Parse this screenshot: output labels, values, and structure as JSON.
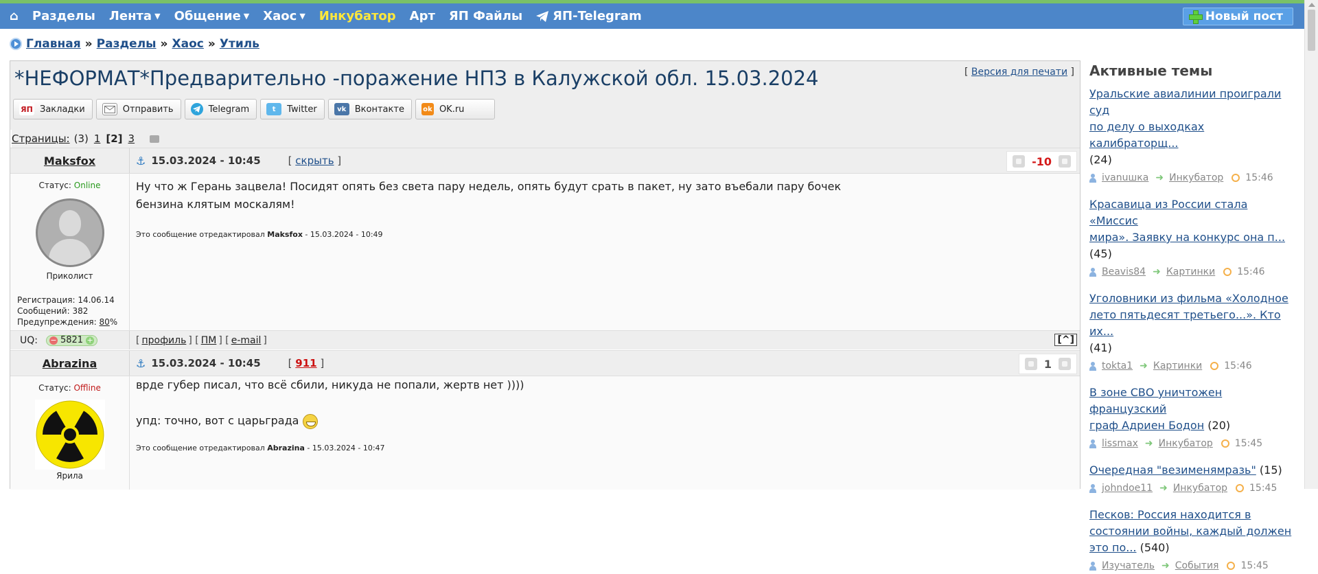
{
  "nav": {
    "home_icon": "home-icon",
    "items": [
      {
        "label": "Разделы",
        "dropdown": false
      },
      {
        "label": "Лента",
        "dropdown": true
      },
      {
        "label": "Общение",
        "dropdown": true
      },
      {
        "label": "Хаос",
        "dropdown": true
      },
      {
        "label": "Инкубатор",
        "dropdown": false
      },
      {
        "label": "Арт",
        "dropdown": false
      },
      {
        "label": "ЯП Файлы",
        "dropdown": false
      },
      {
        "label": "ЯП-Telegram",
        "dropdown": false
      }
    ],
    "new_post_label": "Новый пост",
    "colors": {
      "bar": "#4c86c9",
      "accent": "#ffe83a",
      "strip": "#79c168"
    }
  },
  "breadcrumb": {
    "items": [
      "Главная",
      "Разделы",
      "Хаос",
      "Утиль"
    ],
    "separator": "»"
  },
  "topic": {
    "title": "*НЕФОРМАТ*Предварительно -поражение НПЗ в Калужской обл. 15.03.2024",
    "print_label": "Версия для печати",
    "share": [
      {
        "label": "Закладки",
        "icon": "yap-icon"
      },
      {
        "label": "Отправить",
        "icon": "mail-icon"
      },
      {
        "label": "Telegram",
        "icon": "telegram-icon"
      },
      {
        "label": "Twitter",
        "icon": "twitter-icon"
      },
      {
        "label": "Вконтакте",
        "icon": "vk-icon"
      },
      {
        "label": "OK.ru",
        "icon": "ok-icon"
      }
    ],
    "pages": {
      "label": "Страницы:",
      "total": "(3)",
      "p1": "1",
      "current": "[2]",
      "p3": "3"
    }
  },
  "posts": [
    {
      "author": "Maksfox",
      "date": "15.03.2024 - 10:45",
      "action": "скрыть",
      "rating": "-10",
      "status_label": "Статус:",
      "status": "Online",
      "rank": "Приколист",
      "reg": "Регистрация: 14.06.14",
      "messages": "Сообщений: 382",
      "warn_label": "Предупреждения:",
      "warn_value": "80",
      "warn_suffix": "%",
      "text_line1": "Ну что ж Герань зацвела! Посидят опять без света пару недель, опять будут срать в пакет, ну зато въебали пару бочек",
      "text_line2": "бензина клятым москалям!",
      "edited_prefix": "Это сообщение отредактировал",
      "edited_by": "Maksfox",
      "edited_time": "- 15.03.2024 - 10:49",
      "uq_label": "UQ:",
      "uq_value": "5821",
      "foot_links": [
        "профиль",
        "ПМ",
        "e-mail"
      ],
      "to_top": "[^]"
    },
    {
      "author": "Abrazina",
      "date": "15.03.2024 - 10:45",
      "action": "911",
      "rating": "1",
      "status_label": "Статус:",
      "status": "Offline",
      "rank": "Ярила",
      "text_line1": "врде губер писал, что всё сбили, никуда не попали, жертв нет ))))",
      "text_line2": "упд: точно, вот с царьграда",
      "edited_prefix": "Это сообщение отредактировал",
      "edited_by": "Abrazina",
      "edited_time": "- 15.03.2024 - 10:47"
    }
  ],
  "sidebar": {
    "title": "Активные темы",
    "topics": [
      {
        "line1": "Уральские авиалинии проиграли суд",
        "line2": "по делу о выходках калибраторщ...",
        "count": "(24)",
        "user": "ivanuшка",
        "section": "Инкубатор",
        "time": "15:46"
      },
      {
        "line1": "Красавица из России стала «Миссис",
        "line2": "мира». Заявку на конкурс она п...",
        "count": "(45)",
        "user": "Beavis84",
        "section": "Картинки",
        "time": "15:46"
      },
      {
        "line1": "Уголовники из фильма «Холодное",
        "line2": "лето пятьдесят третьего...». Кто их...",
        "count": "(41)",
        "user": "tokta1",
        "section": "Картинки",
        "time": "15:46"
      },
      {
        "line1": "В зоне СВО уничтожен французский",
        "line2": "граф Адриен Бодон",
        "count": "(20)",
        "user": "lissmax",
        "section": "Инкубатор",
        "time": "15:45"
      },
      {
        "line1": "Очередная \"везименямразь\"",
        "count": "(15)",
        "user": "johndoe11",
        "section": "Инкубатор",
        "time": "15:45"
      },
      {
        "line1": "Песков: Россия находится в",
        "line2": "состоянии войны, каждый должен",
        "line3": "это по...",
        "count": "(540)",
        "user": "Изучатель",
        "section": "События",
        "time": "15:45"
      }
    ]
  }
}
